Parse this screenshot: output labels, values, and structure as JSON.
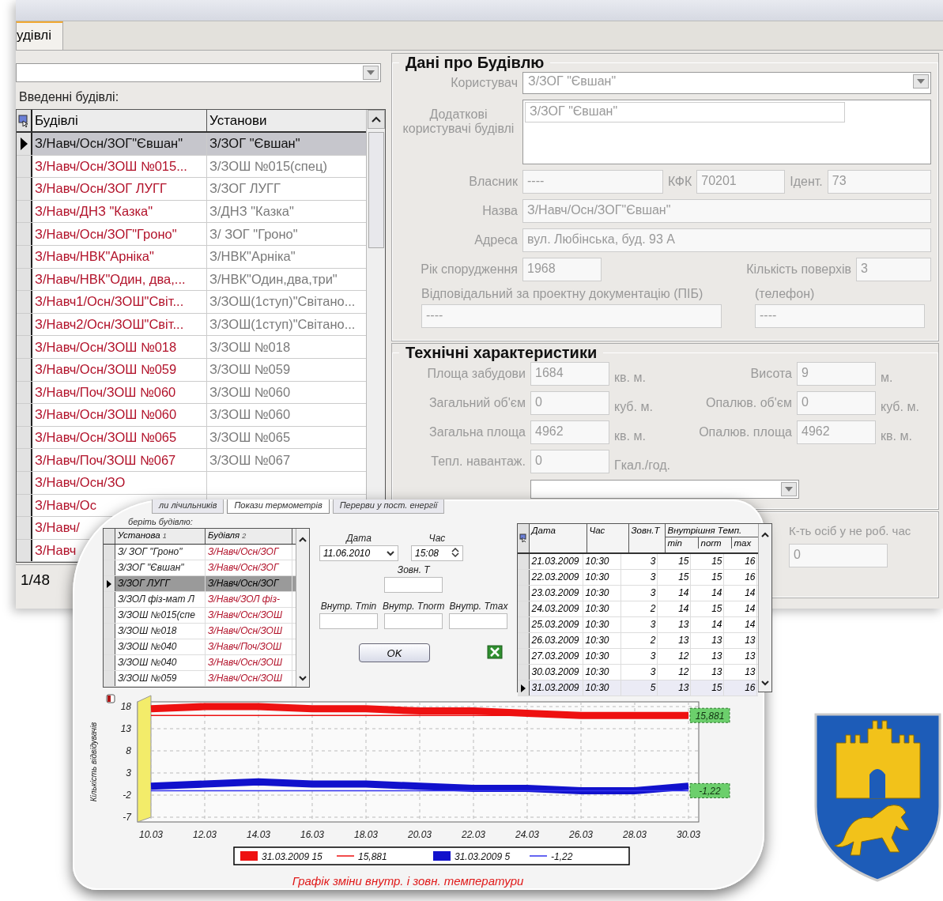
{
  "main_window": {
    "tab": {
      "label": "удівлі",
      "selected": true
    },
    "buildings": {
      "label": "Введенні будівлі:",
      "columns": [
        "Будівлі",
        "Установи"
      ],
      "rows": [
        {
          "building": "З/Навч/Осн/ЗОГ\"Євшан\"",
          "institution": "З/ЗОГ \"Євшан\"",
          "selected": true
        },
        {
          "building": "З/Навч/Осн/ЗОШ №015...",
          "institution": "З/ЗОШ №015(спец)",
          "selected": false
        },
        {
          "building": "З/Навч/Осн/ЗОГ ЛУГГ",
          "institution": "З/ЗОГ ЛУГГ",
          "selected": false
        },
        {
          "building": "З/Навч/ДНЗ \"Казка\"",
          "institution": "З/ДНЗ \"Казка\"",
          "selected": false
        },
        {
          "building": "З/Навч/Осн/ЗОГ\"Гроно\"",
          "institution": "З/ ЗОГ \"Гроно\"",
          "selected": false
        },
        {
          "building": "З/Навч/НВК\"Арніка\"",
          "institution": "З/НВК\"Арніка\"",
          "selected": false
        },
        {
          "building": "З/Навч/НВК\"Один, два,...",
          "institution": "З/НВК\"Один,два,три\"",
          "selected": false
        },
        {
          "building": "З/Навч1/Осн/ЗОШ\"Світ...",
          "institution": "З/ЗОШ(1ступ)\"Світано...",
          "selected": false
        },
        {
          "building": "З/Навч2/Осн/ЗОШ\"Світ...",
          "institution": "З/ЗОШ(1ступ)\"Світано...",
          "selected": false
        },
        {
          "building": "З/Навч/Осн/ЗОШ №018",
          "institution": "З/ЗОШ №018",
          "selected": false
        },
        {
          "building": "З/Навч/Осн/ЗОШ №059",
          "institution": "З/ЗОШ №059",
          "selected": false
        },
        {
          "building": "З/Навч/Поч/ЗОШ №060",
          "institution": "З/ЗОШ №060",
          "selected": false
        },
        {
          "building": "З/Навч/Осн/ЗОШ №060",
          "institution": "З/ЗОШ №060",
          "selected": false
        },
        {
          "building": "З/Навч/Осн/ЗОШ №065",
          "institution": "З/ЗОШ №065",
          "selected": false
        },
        {
          "building": "З/Навч/Поч/ЗОШ №067",
          "institution": "З/ЗОШ №067",
          "selected": false
        },
        {
          "building": "З/Навч/Осн/ЗО",
          "selected": false
        },
        {
          "building": "З/Навч/Ос",
          "selected": false
        },
        {
          "building": "З/Навч/",
          "selected": false
        },
        {
          "building": "З/Навч",
          "selected": false
        }
      ],
      "counter": "1/48"
    },
    "building_data": {
      "title": "Дані про Будівлю",
      "user": {
        "label": "Користувач",
        "value": "З/ЗОГ \"Євшан\""
      },
      "extra_users": {
        "label": "Додаткові користувачі будівлі",
        "items": [
          "З/ЗОГ \"Євшан\""
        ]
      },
      "owner": {
        "label": "Власник",
        "value": "----"
      },
      "kfk": {
        "label": "КФК",
        "value": "70201"
      },
      "ident": {
        "label": "Ідент.",
        "value": "73"
      },
      "name": {
        "label": "Назва",
        "value": "З/Навч/Осн/ЗОГ\"Євшан\""
      },
      "address": {
        "label": "Адреса",
        "value": "вул. Любінська, буд. 93 А"
      },
      "year": {
        "label": "Рік спорудження",
        "value": "1968"
      },
      "floors": {
        "label": "Кількість поверхів",
        "value": "3"
      },
      "responsible": {
        "label": "Відповідальний за проектну документацію (ПІБ)",
        "value": "----"
      },
      "phone": {
        "label": "(телефон)",
        "value": "----"
      }
    },
    "technical": {
      "title": "Технічні характеристики",
      "rows": [
        {
          "left": {
            "label": "Площа забудови",
            "value": "1684",
            "unit": "кв. м."
          },
          "right": {
            "label": "Висота",
            "value": "9",
            "unit": "м."
          }
        },
        {
          "left": {
            "label": "Загальний об'єм",
            "value": "0",
            "unit": "куб. м."
          },
          "right": {
            "label": "Опалюв. об'єм",
            "value": "0",
            "unit": "куб. м."
          }
        },
        {
          "left": {
            "label": "Загальна площа",
            "value": "4962",
            "unit": "кв. м."
          },
          "right": {
            "label": "Опалюв. площа",
            "value": "4962",
            "unit": "кв. м."
          }
        },
        {
          "left": {
            "label": "Тепл. навантаж.",
            "value": "0",
            "unit": "Гкал./год."
          }
        }
      ]
    },
    "people": {
      "label": "К-ть осіб у не роб. час",
      "value": "0"
    }
  },
  "overlay": {
    "tabs": [
      {
        "label": "ли лічильників",
        "selected": false
      },
      {
        "label": "Покази термометрів",
        "selected": true
      },
      {
        "label": "Перерви у пост. енергії",
        "selected": false
      }
    ],
    "picker": {
      "label": "беріть будівлю:",
      "columns": [
        {
          "label": "Установа",
          "sort": "1"
        },
        {
          "label": "Будівля",
          "sort": "2"
        }
      ],
      "rows": [
        {
          "cells": [
            "З/ ЗОГ \"Гроно\"",
            "З/Навч/Осн/ЗОГ"
          ],
          "selected": false
        },
        {
          "cells": [
            "З/ЗОГ \"Євшан\"",
            "З/Навч/Осн/ЗОГ"
          ],
          "selected": false
        },
        {
          "cells": [
            "З/ЗОГ ЛУГГ",
            "З/Навч/Осн/ЗОГ"
          ],
          "selected": true
        },
        {
          "cells": [
            "З/ЗОЛ фіз-мат Л",
            "З/Навч/ЗОЛ фіз-"
          ],
          "selected": false
        },
        {
          "cells": [
            "З/ЗОШ №015(спе",
            "З/Навч/Осн/ЗОШ"
          ],
          "selected": false
        },
        {
          "cells": [
            "З/ЗОШ №018",
            "З/Навч/Осн/ЗОШ"
          ],
          "selected": false
        },
        {
          "cells": [
            "З/ЗОШ №040",
            "З/Навч/Поч/ЗОШ"
          ],
          "selected": false
        },
        {
          "cells": [
            "З/ЗОШ №040",
            "З/Навч/Осн/ЗОШ"
          ],
          "selected": false
        },
        {
          "cells": [
            "З/ЗОШ №059",
            "З/Навч/Осн/ЗОШ"
          ],
          "selected": false
        }
      ]
    },
    "date": {
      "label": "Дата",
      "value": "11.06.2010"
    },
    "time": {
      "label": "Час",
      "value": "15:08"
    },
    "outside_t": {
      "label": "Зовн. Т"
    },
    "inside_fields": [
      {
        "label": "Внутр. Tmin"
      },
      {
        "label": "Внутр. Tnorm"
      },
      {
        "label": "Внутр. Tmax"
      }
    ],
    "ok_button": "OK",
    "readings": {
      "columns": [
        "Дата",
        "Час",
        "Зовн.Т"
      ],
      "group": "Внутрішня Темп.",
      "subcolumns": [
        "min",
        "norm",
        "max"
      ],
      "rows": [
        {
          "cells": [
            "21.03.2009",
            "10:30",
            "3",
            "15",
            "15",
            "16"
          ],
          "selected": false
        },
        {
          "cells": [
            "22.03.2009",
            "10:30",
            "3",
            "15",
            "15",
            "16"
          ],
          "selected": false
        },
        {
          "cells": [
            "23.03.2009",
            "10:30",
            "3",
            "14",
            "14",
            "14"
          ],
          "selected": false
        },
        {
          "cells": [
            "24.03.2009",
            "10:30",
            "2",
            "14",
            "15",
            "14"
          ],
          "selected": false
        },
        {
          "cells": [
            "25.03.2009",
            "10:30",
            "3",
            "13",
            "14",
            "14"
          ],
          "selected": false
        },
        {
          "cells": [
            "26.03.2009",
            "10:30",
            "2",
            "13",
            "13",
            "13"
          ],
          "selected": false
        },
        {
          "cells": [
            "27.03.2009",
            "10:30",
            "3",
            "12",
            "13",
            "13"
          ],
          "selected": false
        },
        {
          "cells": [
            "30.03.2009",
            "10:30",
            "3",
            "12",
            "13",
            "13"
          ],
          "selected": false
        },
        {
          "cells": [
            "31.03.2009",
            "10:30",
            "5",
            "13",
            "15",
            "16"
          ],
          "selected": true
        }
      ]
    },
    "chart": {
      "chart_data": {
        "type": "line",
        "title": "Графік зміни внутр. і зовн. температури",
        "ylabel": "Кількість відвідувачів",
        "categories": [
          "10.03",
          "12.03",
          "14.03",
          "16.03",
          "18.03",
          "20.03",
          "22.03",
          "24.03",
          "26.03",
          "28.03",
          "30.03"
        ],
        "series": [
          {
            "name": "31.03.2009 15",
            "color": "#ee1111",
            "values": [
              17.5,
              18,
              18,
              17.5,
              17.5,
              17,
              17,
              16.5,
              16,
              16,
              16
            ]
          },
          {
            "name": "15,881",
            "color": "#ee1111",
            "values": [
              16,
              16,
              16,
              16,
              16,
              16,
              16,
              16,
              16,
              16,
              16
            ]
          },
          {
            "name": "31.03.2009 5",
            "color": "#1111cc",
            "values": [
              0,
              0.5,
              1,
              0.5,
              0.5,
              0,
              -0.5,
              -0.5,
              -1,
              -1,
              0
            ]
          },
          {
            "name": "-1,22",
            "color": "#3333ee",
            "values": [
              -1,
              -1,
              -1,
              -1,
              -1,
              -1,
              -1,
              -1,
              -1,
              -1,
              -1
            ]
          }
        ],
        "ylim": [
          -7,
          18
        ],
        "yticks": [
          18,
          13,
          8,
          3,
          -2,
          -7
        ],
        "grid": true,
        "legend": true,
        "annotations": [
          "15,881",
          "-1,22"
        ]
      }
    }
  }
}
